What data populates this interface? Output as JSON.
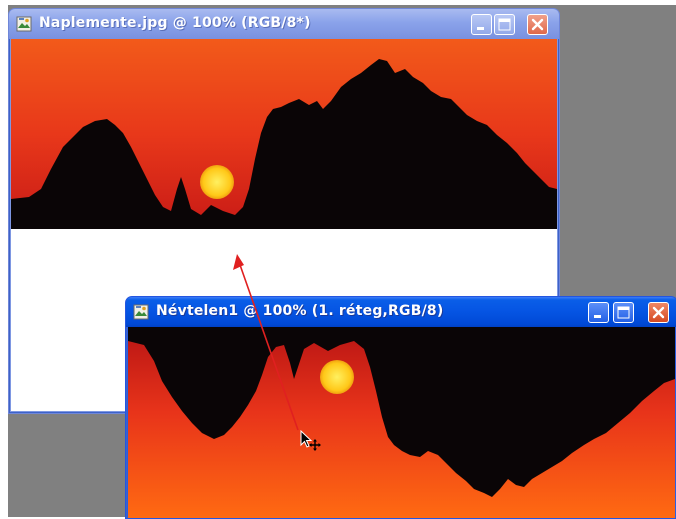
{
  "windows": [
    {
      "title": "Naplemente.jpg @ 100% (RGB/8*)",
      "state": "inactive",
      "buttons": [
        "minimize",
        "maximize",
        "close"
      ]
    },
    {
      "title": "Névtelen1 @ 100% (1. réteg,RGB/8)",
      "state": "active",
      "buttons": [
        "minimize",
        "maximize",
        "close"
      ]
    }
  ],
  "icons": {
    "document": "photoshop-document-icon",
    "cursor": "move-cursor-icon"
  },
  "colors": {
    "active_titlebar": "#0554e3",
    "inactive_titlebar": "#8aa2ea",
    "close_button": "#d54a22",
    "canvas_background": "#ffffff",
    "workspace": "#808080",
    "drag_arrow": "#e02020",
    "sky_top": "#d8301a",
    "sky_bottom": "#ff7a10",
    "sun": "#ffd020"
  }
}
